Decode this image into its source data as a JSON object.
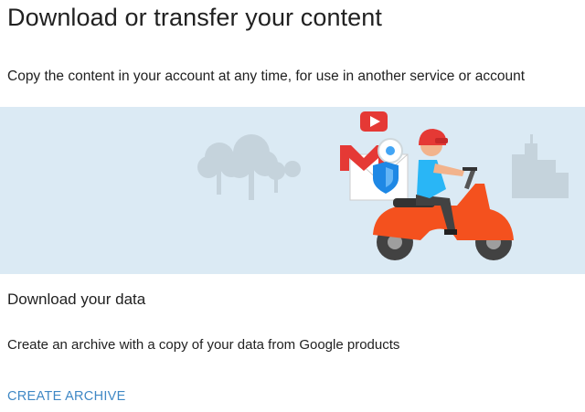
{
  "page": {
    "title": "Download or transfer your content",
    "subtitle": "Copy the content in your account at any time, for use in another service or account"
  },
  "download_section": {
    "title": "Download your data",
    "description": "Create an archive with a copy of your data from Google products",
    "action_label": "CREATE ARCHIVE"
  },
  "colors": {
    "banner_background": "#dbeaf4",
    "link": "#3f88c5",
    "scooter": "#f4511e",
    "rider_shirt": "#29b6f6"
  },
  "illustration": {
    "icons": [
      "trees-icon",
      "buildings-icon",
      "scooter-rider-icon",
      "youtube-icon",
      "gmail-icon",
      "chrome-icon",
      "shield-icon"
    ]
  }
}
